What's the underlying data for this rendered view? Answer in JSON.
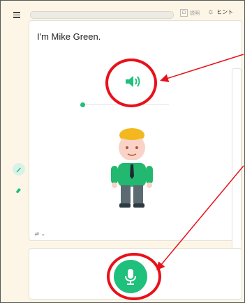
{
  "lesson": {
    "sentence": "I'm Mike Green."
  },
  "toolbar": {
    "explain_label": "説明",
    "hint_label": "ヒント"
  },
  "audio": {
    "progress": 0.0
  },
  "lesson_progress": 0.0,
  "colors": {
    "accent": "#1fbf7c",
    "annotation": "#e8111a",
    "background": "#fdf6e6"
  },
  "icons": {
    "menu": "menu-icon",
    "hint": "lightbulb-icon",
    "speaker": "speaker-icon",
    "microphone": "microphone-icon",
    "pencil": "pencil-icon",
    "eraser": "eraser-icon",
    "language": "language-toggle-icon"
  }
}
